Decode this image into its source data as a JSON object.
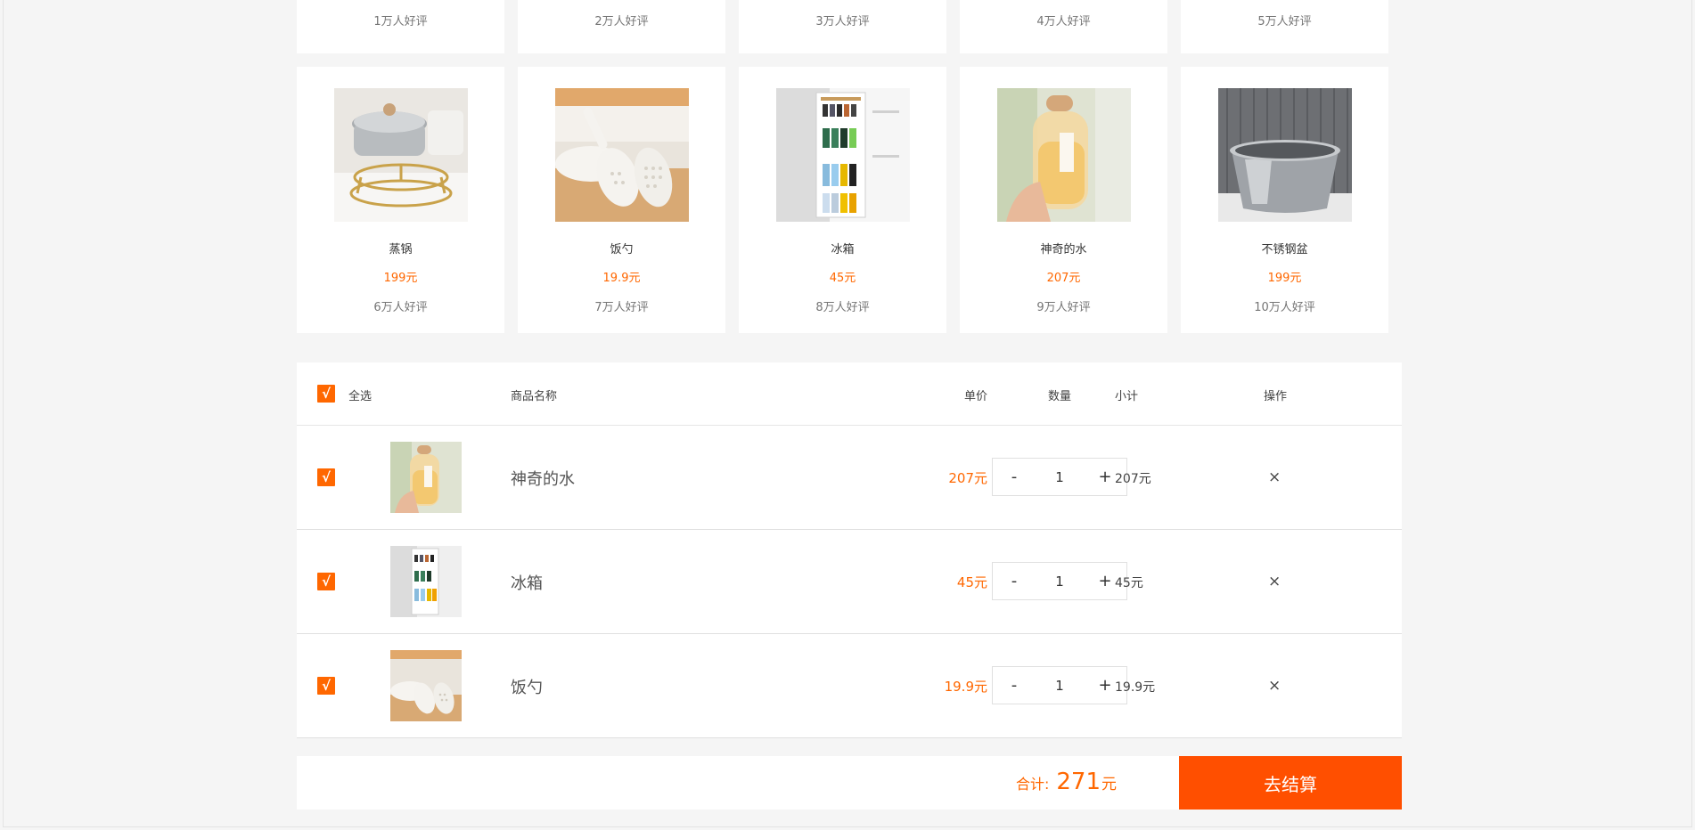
{
  "top_row": [
    {
      "reviews": "1万人好评"
    },
    {
      "reviews": "2万人好评"
    },
    {
      "reviews": "3万人好评"
    },
    {
      "reviews": "4万人好评"
    },
    {
      "reviews": "5万人好评"
    }
  ],
  "products": [
    {
      "name": "蒸锅",
      "price": "199元",
      "reviews": "6万人好评",
      "image": "steamer-pot-image"
    },
    {
      "name": "饭勺",
      "price": "19.9元",
      "reviews": "7万人好评",
      "image": "rice-spoon-image"
    },
    {
      "name": "冰箱",
      "price": "45元",
      "reviews": "8万人好评",
      "image": "fridge-rack-image"
    },
    {
      "name": "神奇的水",
      "price": "207元",
      "reviews": "9万人好评",
      "image": "water-bottle-image"
    },
    {
      "name": "不锈钢盆",
      "price": "199元",
      "reviews": "10万人好评",
      "image": "steel-basin-image"
    }
  ],
  "cart": {
    "header": {
      "select_all_check": "√",
      "select_all": "全选",
      "name": "商品名称",
      "price": "单价",
      "qty": "数量",
      "subtotal": "小计",
      "action": "操作"
    },
    "items": [
      {
        "check": "√",
        "name": "神奇的水",
        "price": "207元",
        "minus": "-",
        "qty": "1",
        "plus": "+",
        "subtotal": "207元",
        "delete": "×"
      },
      {
        "check": "√",
        "name": "冰箱",
        "price": "45元",
        "minus": "-",
        "qty": "1",
        "plus": "+",
        "subtotal": "45元",
        "delete": "×"
      },
      {
        "check": "√",
        "name": "饭勺",
        "price": "19.9元",
        "minus": "-",
        "qty": "1",
        "plus": "+",
        "subtotal": "19.9元",
        "delete": "×"
      }
    ],
    "footer": {
      "total_label": "合计:",
      "total_value": "271",
      "total_unit": "元",
      "checkout": "去结算"
    }
  },
  "colors": {
    "accent": "#ff6700",
    "checkout": "#ff4f00",
    "background": "#f5f5f5"
  }
}
